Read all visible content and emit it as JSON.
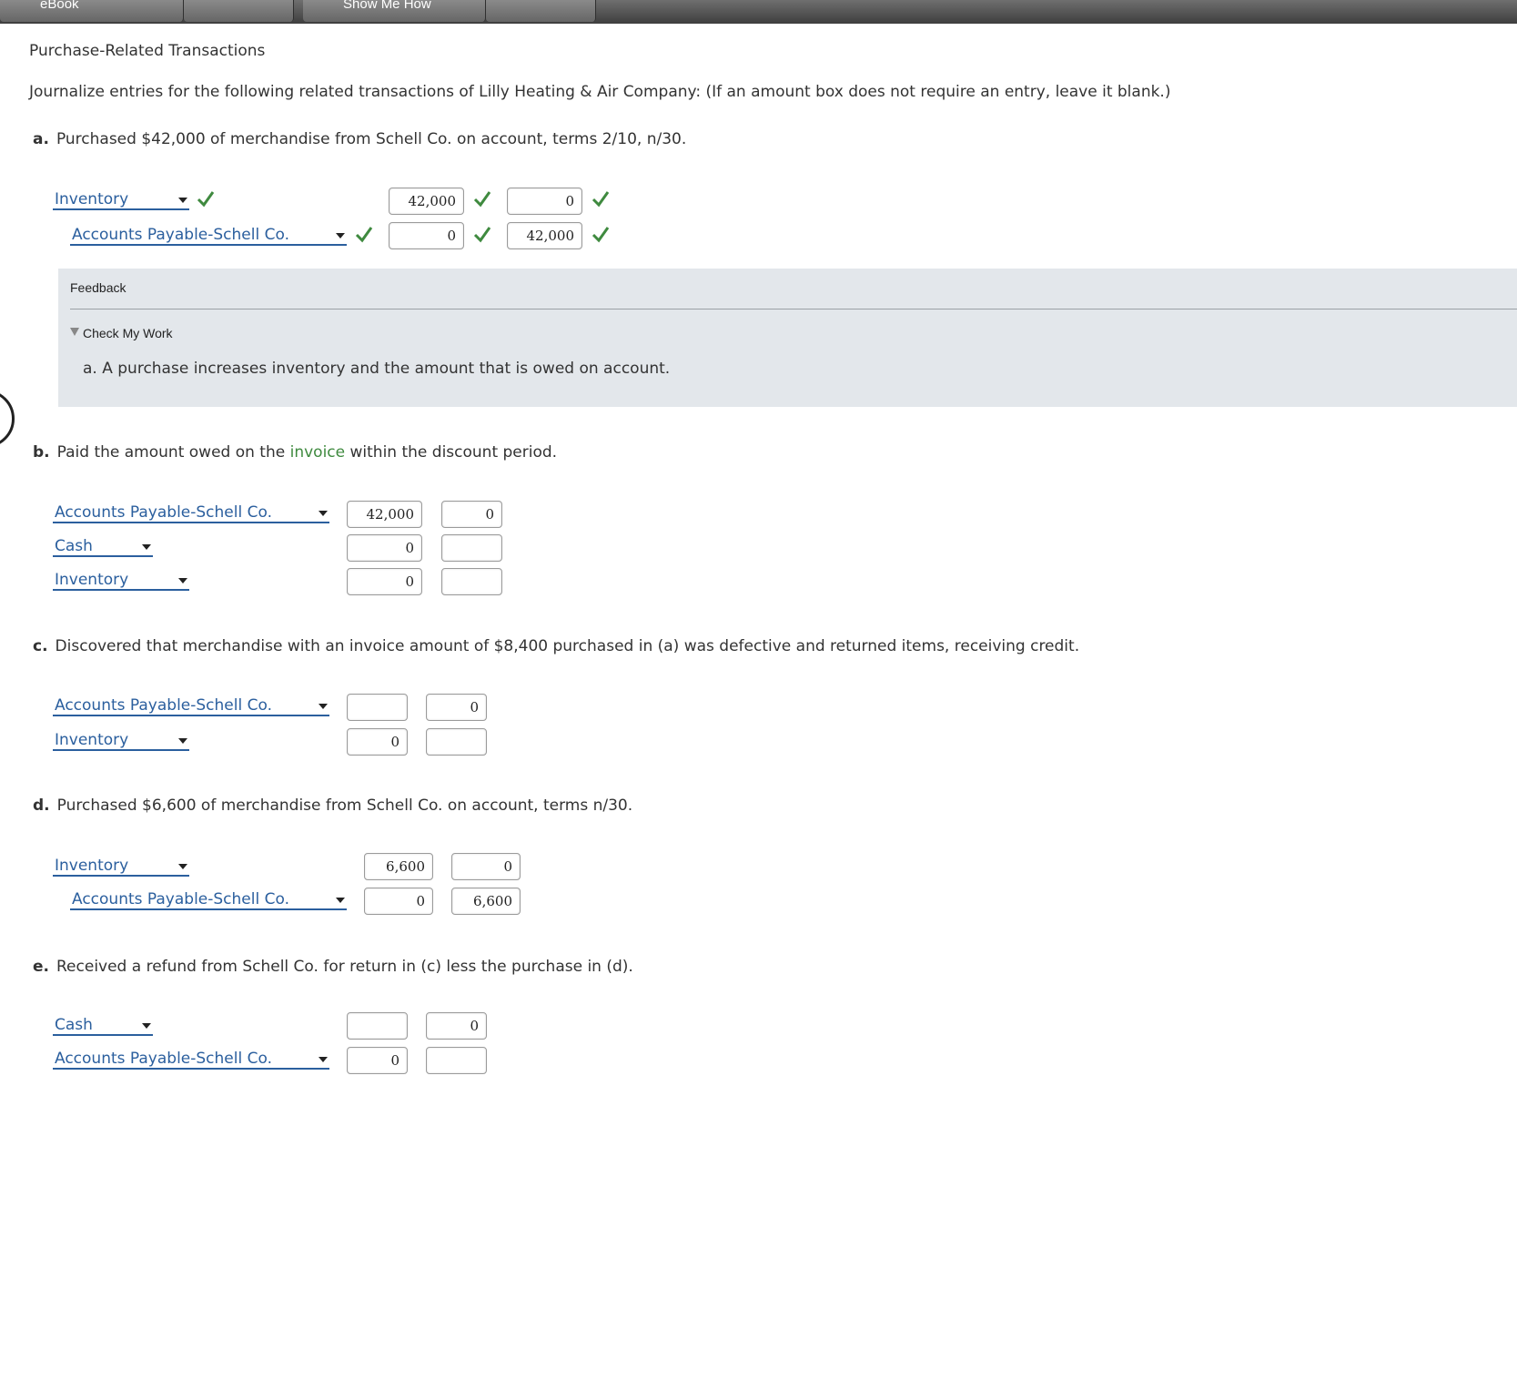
{
  "topbar": {
    "tabs": [
      "eBook",
      "",
      "Show Me How",
      ""
    ]
  },
  "page": {
    "title": "Purchase-Related Transactions",
    "instructions": "Journalize entries for the following related transactions of Lilly Heating & Air Company: (If an amount box does not require an entry, leave it blank.)"
  },
  "a": {
    "letter": "a.",
    "text": "Purchased $42,000 of merchandise from Schell Co. on account, terms 2/10, n/30.",
    "rows": [
      {
        "account": "Inventory",
        "debit": "42,000",
        "credit": "0"
      },
      {
        "account": "Accounts Payable-Schell Co.",
        "debit": "0",
        "credit": "42,000"
      }
    ]
  },
  "feedback": {
    "title": "Feedback",
    "toggle": "Check My Work",
    "text": "a. A purchase increases inventory and the amount that is owed on account."
  },
  "b": {
    "letter": "b.",
    "text_before": "Paid the amount owed on the ",
    "link": "invoice",
    "text_after": " within the discount period.",
    "rows": [
      {
        "account": "Accounts Payable-Schell Co.",
        "debit": "42,000",
        "credit": "0"
      },
      {
        "account": "Cash",
        "debit": "0",
        "credit": ""
      },
      {
        "account": "Inventory",
        "debit": "0",
        "credit": ""
      }
    ]
  },
  "c": {
    "letter": "c.",
    "text": "Discovered that merchandise with an invoice amount of $8,400 purchased in (a) was defective and returned items, receiving credit.",
    "rows": [
      {
        "account": "Accounts Payable-Schell Co.",
        "debit": "",
        "credit": "0"
      },
      {
        "account": "Inventory",
        "debit": "0",
        "credit": ""
      }
    ]
  },
  "d": {
    "letter": "d.",
    "text": "Purchased $6,600 of merchandise from Schell Co. on account, terms n/30.",
    "rows": [
      {
        "account": "Inventory",
        "debit": "6,600",
        "credit": "0"
      },
      {
        "account": "Accounts Payable-Schell Co.",
        "debit": "0",
        "credit": "6,600"
      }
    ]
  },
  "e": {
    "letter": "e.",
    "text": "Received a refund from Schell Co. for return in (c) less the purchase in (d).",
    "rows": [
      {
        "account": "Cash",
        "debit": "",
        "credit": "0"
      },
      {
        "account": "Accounts Payable-Schell Co.",
        "debit": "0",
        "credit": ""
      }
    ]
  },
  "colors": {
    "check": "#3f8a3f",
    "link_blue": "#2b5f9e",
    "feedback_bg": "#e3e7eb",
    "green_word": "#3f8a3f"
  },
  "icons": {
    "check": "checkmark-icon",
    "dropdown": "chevron-down-icon"
  }
}
